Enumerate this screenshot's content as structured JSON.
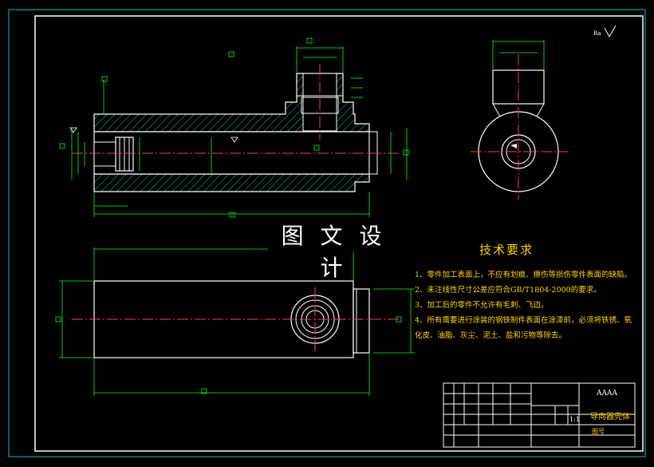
{
  "watermark": "图 文 设 计",
  "notes": {
    "title": "技术要求",
    "items": [
      "1、零件加工表面上，不应有划痕、擦伤等损伤零件表面的缺陷。",
      "2、未注线性尺寸公差应符合GB/T1804-2000的要求。",
      "3、加工后的零件不允许有毛刺、飞边。",
      "4、所有需要进行涂装的钢铁制件表面在涂漆前，必须将铁锈、氧",
      "化皮、油脂、灰尘、泥土、盐和污物等除去。"
    ]
  },
  "title_block": {
    "code": "AAAA",
    "part_name": "导向器壳体",
    "drawing_no_label": "图号",
    "scale": "1:1"
  },
  "roughness_symbol": "Ra"
}
